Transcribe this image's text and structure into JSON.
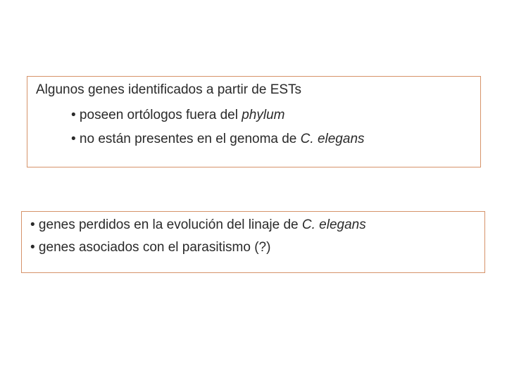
{
  "box1": {
    "title": "Algunos genes identificados a partir de ESTs",
    "items": [
      {
        "bullet": "•",
        "pre": " poseen ortólogos fuera del ",
        "em": "phylum",
        "post": ""
      },
      {
        "bullet": "•",
        "pre": " no están presentes en el genoma de ",
        "em": "C. elegans",
        "post": ""
      }
    ]
  },
  "box2": {
    "items": [
      {
        "bullet": "•",
        "pre": " genes perdidos en la evolución del linaje de ",
        "em": "C. elegans",
        "post": ""
      },
      {
        "bullet": "•",
        "pre": " genes asociados con el parasitismo (?)",
        "em": "",
        "post": ""
      }
    ]
  }
}
